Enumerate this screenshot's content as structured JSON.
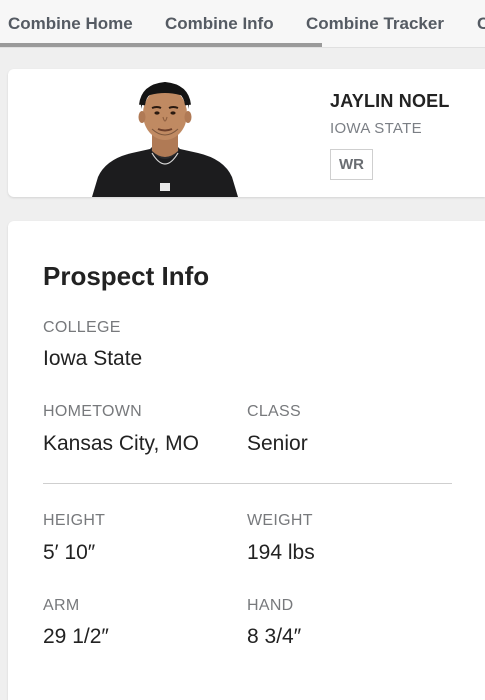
{
  "tabs": [
    {
      "label": "Combine Home"
    },
    {
      "label": "Combine Info"
    },
    {
      "label": "Combine Tracker"
    },
    {
      "label": "C"
    }
  ],
  "player": {
    "name": "JAYLIN NOEL",
    "school": "IOWA STATE",
    "position": "WR"
  },
  "prospect": {
    "title": "Prospect Info",
    "college_label": "COLLEGE",
    "college": "Iowa State",
    "hometown_label": "HOMETOWN",
    "hometown": "Kansas City, MO",
    "class_label": "CLASS",
    "class": "Senior",
    "height_label": "HEIGHT",
    "height": "5′ 10″",
    "weight_label": "WEIGHT",
    "weight": "194 lbs",
    "arm_label": "ARM",
    "arm": "29 1/2″",
    "hand_label": "HAND",
    "hand": "8 3/4″"
  }
}
